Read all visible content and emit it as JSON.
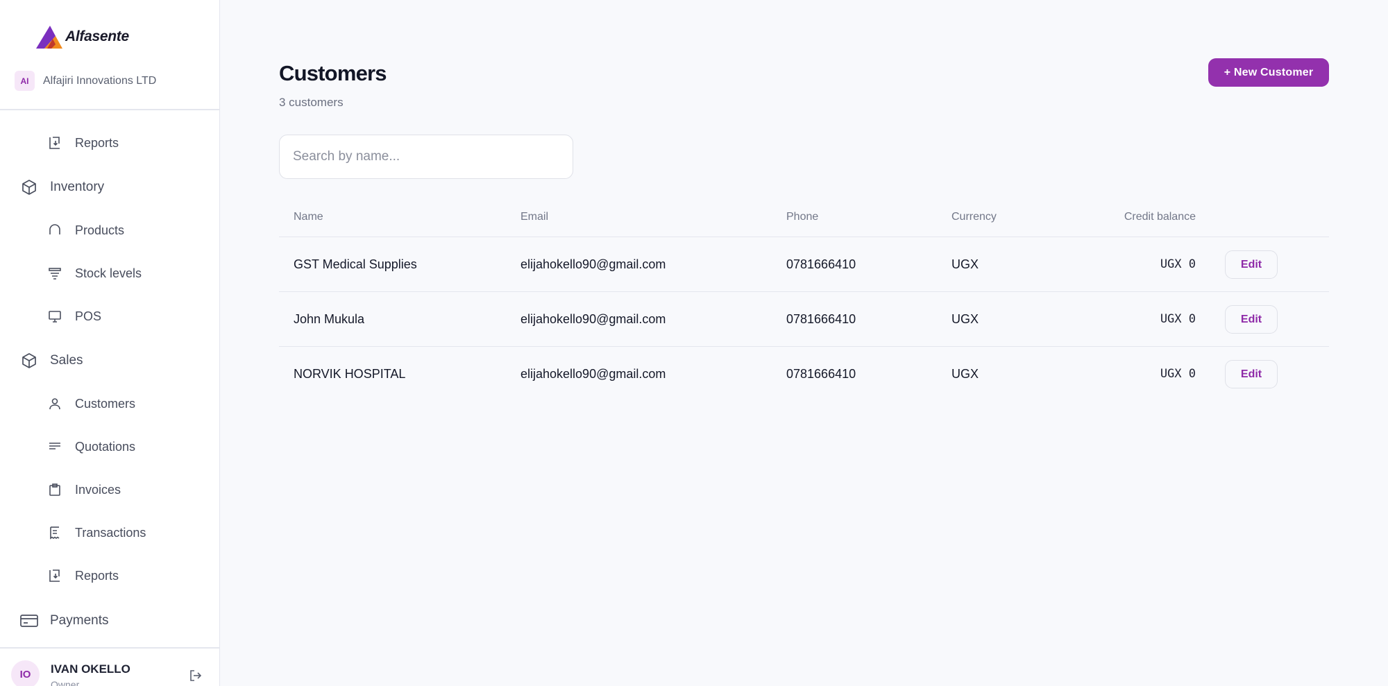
{
  "brand": {
    "name": "Alfasente"
  },
  "org": {
    "initials": "AI",
    "name": "Alfajiri Innovations LTD"
  },
  "sidebar": {
    "items": [
      {
        "label": "Reports",
        "icon": "report-icon",
        "level": "sub"
      },
      {
        "label": "Inventory",
        "icon": "box-icon",
        "level": "top"
      },
      {
        "label": "Products",
        "icon": "product-icon",
        "level": "sub"
      },
      {
        "label": "Stock levels",
        "icon": "stock-icon",
        "level": "sub"
      },
      {
        "label": "POS",
        "icon": "monitor-icon",
        "level": "sub"
      },
      {
        "label": "Sales",
        "icon": "box-icon",
        "level": "top"
      },
      {
        "label": "Customers",
        "icon": "user-icon",
        "level": "sub"
      },
      {
        "label": "Quotations",
        "icon": "lines-icon",
        "level": "sub"
      },
      {
        "label": "Invoices",
        "icon": "clipboard-icon",
        "level": "sub"
      },
      {
        "label": "Transactions",
        "icon": "receipt-icon",
        "level": "sub"
      },
      {
        "label": "Reports",
        "icon": "report-icon",
        "level": "sub"
      },
      {
        "label": "Payments",
        "icon": "card-icon",
        "level": "top"
      }
    ]
  },
  "user": {
    "initials": "IO",
    "name": "IVAN OKELLO",
    "role": "Owner"
  },
  "page": {
    "title": "Customers",
    "subtitle": "3 customers",
    "new_button": "+ New Customer"
  },
  "search": {
    "placeholder": "Search by name...",
    "value": ""
  },
  "table": {
    "columns": [
      "Name",
      "Email",
      "Phone",
      "Currency",
      "Credit balance"
    ],
    "rows": [
      {
        "name": "GST Medical Supplies",
        "email": "elijahokello90@gmail.com",
        "phone": "0781666410",
        "currency": "UGX",
        "credit": "UGX 0",
        "action": "Edit"
      },
      {
        "name": "John Mukula",
        "email": "elijahokello90@gmail.com",
        "phone": "0781666410",
        "currency": "UGX",
        "credit": "UGX 0",
        "action": "Edit"
      },
      {
        "name": "NORVIK HOSPITAL",
        "email": "elijahokello90@gmail.com",
        "phone": "0781666410",
        "currency": "UGX",
        "credit": "UGX 0",
        "action": "Edit"
      }
    ]
  },
  "colors": {
    "accent": "#9331ad",
    "accent_light": "#f6e7f8",
    "background": "#f8f9fc"
  }
}
